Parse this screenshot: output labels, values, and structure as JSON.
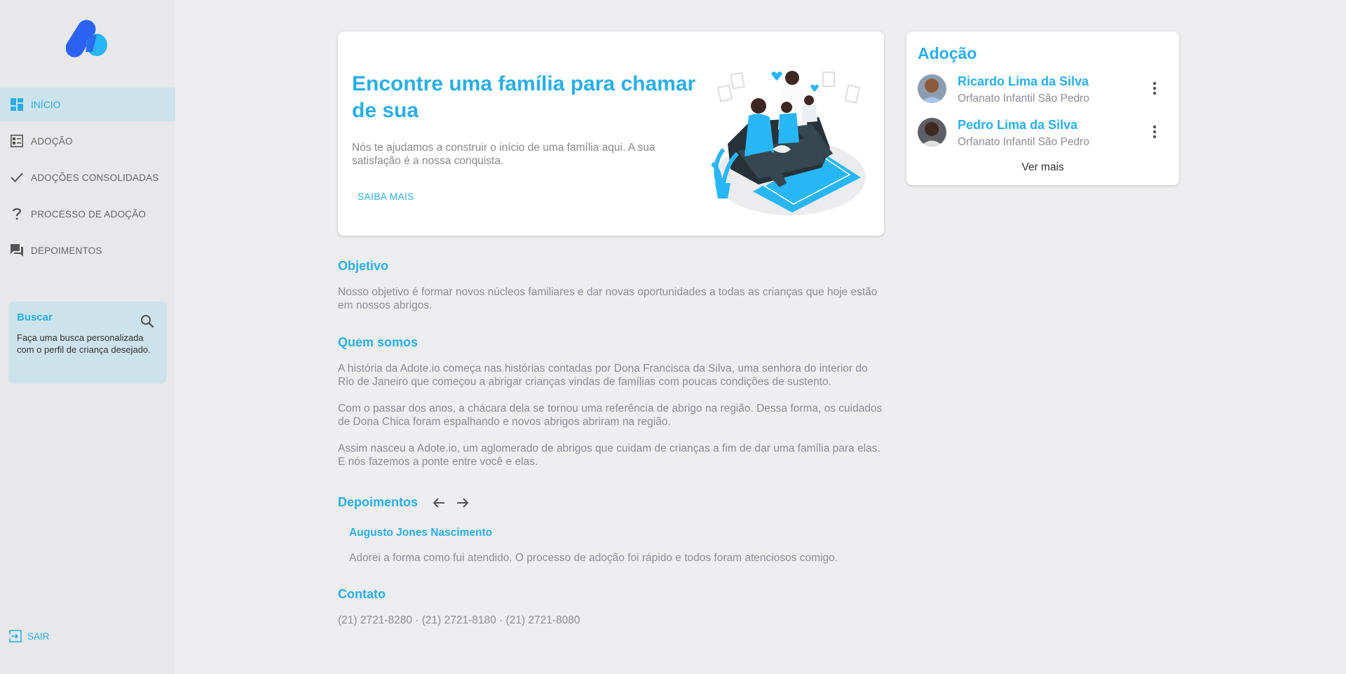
{
  "sidebar": {
    "items": [
      {
        "label": "INÍCIO",
        "icon": "dashboard-icon"
      },
      {
        "label": "ADOÇÃO",
        "icon": "list-icon"
      },
      {
        "label": "ADOÇÕES CONSOLIDADAS",
        "icon": "check-icon"
      },
      {
        "label": "PROCESSO DE ADOÇÃO",
        "icon": "help-icon"
      },
      {
        "label": "DEPOIMENTOS",
        "icon": "forum-icon"
      }
    ],
    "search": {
      "title": "Buscar",
      "description": "Faça uma busca personalizada com o perfil de criança desejado."
    },
    "logout_label": "SAIR"
  },
  "hero": {
    "title": "Encontre uma família para chamar de sua",
    "description": "Nós te ajudamos a construir o início de uma família aqui. A sua satisfação é a nossa conquista.",
    "button_label": "SAIBA MAIS"
  },
  "objetivo": {
    "title": "Objetivo",
    "text": "Nosso objetivo é formar novos núcleos familiares e dar novas oportunidades a todas as crianças que hoje estão em nossos abrigos."
  },
  "quem_somos": {
    "title": "Quem somos",
    "paragraphs": [
      "A história da Adote.io começa nas histórias contadas por Dona Francisca da Silva, uma senhora do interior do Rio de Janeiro que começou a abrigar crianças vindas de famílias com poucas condições de sustento.",
      "Com o passar dos anos, a chácara dela se tornou uma referência de abrigo na região. Dessa forma, os cuidados de Dona Chica foram espalhando e novos abrigos abriram na região.",
      "Assim nasceu a Adote.io, um aglomerado de abrigos que cuidam de crianças a fim de dar uma família para elas. E nós fazemos a ponte entre você e elas."
    ]
  },
  "depoimentos": {
    "title": "Depoimentos",
    "author": "Augusto Jones Nascimento",
    "text": "Adorei a forma como fui atendido. O processo de adoção foi rápido e todos foram atenciosos comigo."
  },
  "contato": {
    "title": "Contato",
    "phones": "(21) 2721-8280 · (21) 2721-8180 · (21) 2721-8080"
  },
  "adocao": {
    "title": "Adoção",
    "children": [
      {
        "name": "Ricardo Lima da Silva",
        "org": "Orfanato Infantil São Pedro"
      },
      {
        "name": "Pedro Lima da Silva",
        "org": "Orfanato Infantil São Pedro"
      }
    ],
    "more_label": "Ver mais"
  },
  "colors": {
    "accent": "#29aee6",
    "muted": "#8c8c96",
    "sidebar_active": "#cde3ec"
  }
}
